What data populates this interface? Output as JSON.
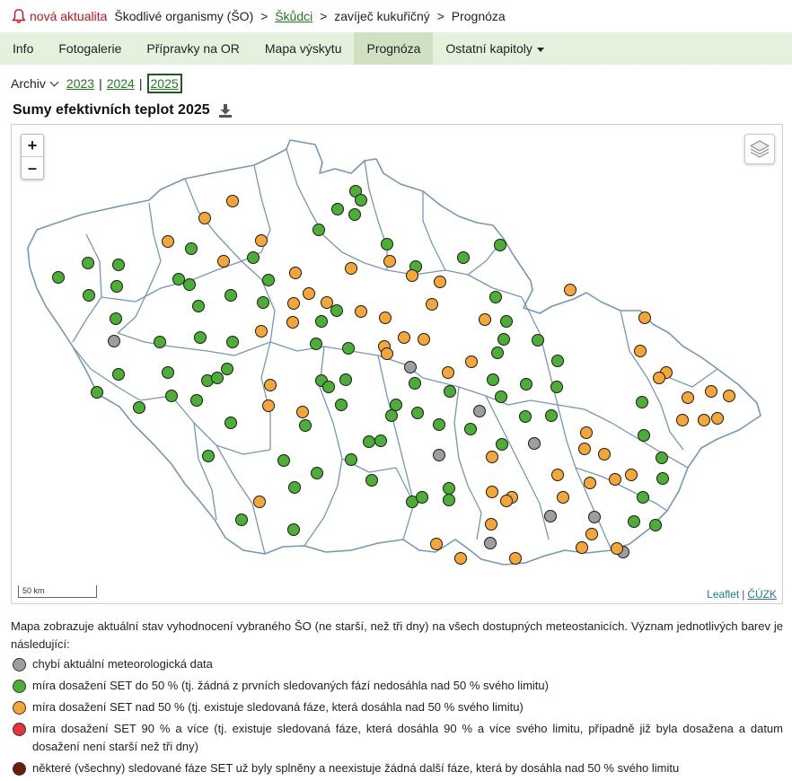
{
  "header": {
    "news_label": "nová aktualita",
    "breadcrumb": [
      {
        "label": "Škodlivé organismy (ŠO)",
        "link": false
      },
      {
        "label": "Škůdci",
        "link": true
      },
      {
        "label": "zavíječ kukuřičný",
        "link": false
      },
      {
        "label": "Prognóza",
        "link": false
      }
    ],
    "separator": ">"
  },
  "nav": {
    "items": [
      {
        "label": "Info",
        "active": false
      },
      {
        "label": "Fotogalerie",
        "active": false
      },
      {
        "label": "Přípravky na OR",
        "active": false
      },
      {
        "label": "Mapa výskytu",
        "active": false
      },
      {
        "label": "Prognóza",
        "active": true
      },
      {
        "label": "Ostatní kapitoly",
        "active": false,
        "dropdown": true
      }
    ]
  },
  "years": {
    "archive_label": "Archiv",
    "items": [
      "2023",
      "2024",
      "2025"
    ],
    "selected": "2025",
    "separator": "|"
  },
  "map": {
    "title": "Sumy efektivních teplot 2025",
    "zoom_in": "+",
    "zoom_out": "–",
    "scale_label": "50 km",
    "attribution_leaflet": "Leaflet",
    "attribution_sep": "|",
    "attribution_cuzk": "ČÚZK",
    "border_color": "#7597b6"
  },
  "colors": {
    "gray": "#9e9e9e",
    "green": "#4caf35",
    "orange": "#f5a637",
    "red": "#e8333a",
    "brown": "#6b1e08"
  },
  "description": "Mapa zobrazuje aktuální stav vyhodnocení vybraného ŠO (ne starší, než tři dny) na všech dostupných meteostanicích. Význam jednotlivých barev je následující:",
  "legend": [
    {
      "color": "#9e9e9e",
      "text": "chybí aktuální meteorologická data"
    },
    {
      "color": "#4caf35",
      "text": "míra dosažení SET do 50 % (tj. žádná z prvních sledovaných fází nedosáhla nad 50 % svého limitu)"
    },
    {
      "color": "#f5a637",
      "text": "míra dosažení SET nad 50 % (tj. existuje sledovaná fáze, která dosáhla nad 50 % svého limitu)"
    },
    {
      "color": "#e8333a",
      "text": "míra dosažení SET 90 % a více (tj. existuje sledovaná fáze, která dosáhla 90 % a více svého limitu, případně již byla dosažena a datum dosažení není starší než tři dny)"
    },
    {
      "color": "#6b1e08",
      "text": "některé (všechny) sledované fáze SET už byly splněny a neexistuje žádná další fáze, která by dosáhla nad 50 % svého limitu"
    }
  ]
}
